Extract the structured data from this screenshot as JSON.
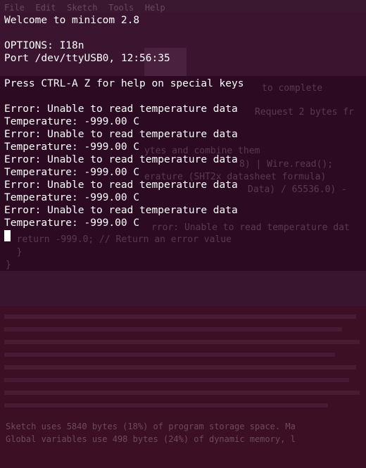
{
  "background_ide": {
    "menu": [
      "File",
      "Edit",
      "Sketch",
      "Tools",
      "Help"
    ],
    "code_fragments": [
      "to complete",
      "Request 2 bytes fr",
      "ytes and combine them",
      "8) | Wire.read();",
      "erature (SHT2x datasheet formula)",
      "Data) / 65536.0) -",
      "rror: Unable to read temperature dat",
      "  return -999.0; // Return an error value",
      "  }",
      "}"
    ],
    "console_lines": [
      "Sketch uses 5840 bytes (18%) of program storage space. Ma",
      "Global variables use 498 bytes (24%) of dynamic memory, l"
    ]
  },
  "terminal": {
    "lines": [
      "Welcome to minicom 2.8",
      "",
      "OPTIONS: I18n",
      "Port /dev/ttyUSB0, 12:56:35",
      "",
      "Press CTRL-A Z for help on special keys",
      "",
      "Error: Unable to read temperature data",
      "Temperature: -999.00 C",
      "Error: Unable to read temperature data",
      "Temperature: -999.00 C",
      "Error: Unable to read temperature data",
      "Temperature: -999.00 C",
      "Error: Unable to read temperature data",
      "Temperature: -999.00 C",
      "Error: Unable to read temperature data",
      "Temperature: -999.00 C"
    ]
  },
  "colors": {
    "terminal_text": "#ffffff",
    "terminal_bg": "#2b0a22"
  }
}
